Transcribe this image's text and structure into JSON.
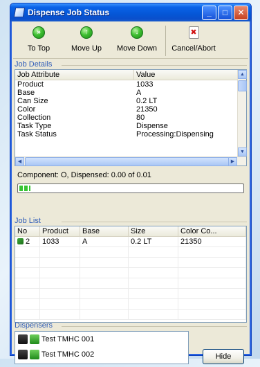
{
  "window": {
    "title": "Dispense Job Status"
  },
  "toolbar": {
    "items": [
      {
        "label": "To Top",
        "glyph": "»"
      },
      {
        "label": "Move Up",
        "glyph": "↑"
      },
      {
        "label": "Move Down",
        "glyph": "↓"
      },
      {
        "label": "Cancel/Abort",
        "glyph": "✖"
      }
    ]
  },
  "job_details": {
    "title": "Job Details",
    "columns": [
      "Job Attribute",
      "Value"
    ],
    "rows": [
      [
        "Product",
        "1033"
      ],
      [
        "Base",
        "A"
      ],
      [
        "Can Size",
        "0.2 LT"
      ],
      [
        "Color",
        "21350"
      ],
      [
        "Collection",
        "80"
      ],
      [
        "Task Type",
        "Dispense"
      ],
      [
        "Task Status",
        "Processing:Dispensing"
      ]
    ]
  },
  "status": {
    "text": "Component: O, Dispensed: 0.00 of 0.01",
    "progress_fraction": 0.05
  },
  "job_list": {
    "title": "Job List",
    "columns": [
      "No",
      "Product",
      "Base",
      "Size",
      "Color Co..."
    ],
    "rows": [
      [
        "2",
        "1033",
        "A",
        "0.2 LT",
        "21350"
      ]
    ]
  },
  "dispensers": {
    "title": "Dispensers",
    "items": [
      "Test TMHC 001",
      "Test TMHC 002"
    ]
  },
  "buttons": {
    "hide": "Hide"
  },
  "colors": {
    "title_bar": "#0556d6",
    "section_title": "#2d5bb8",
    "progress": "#37c433"
  }
}
